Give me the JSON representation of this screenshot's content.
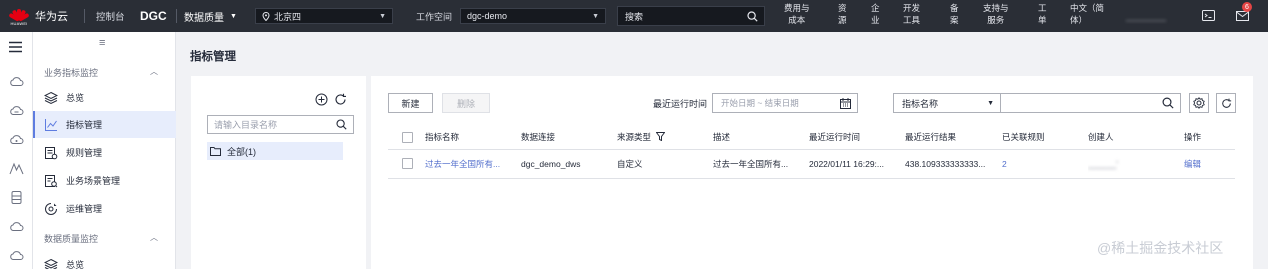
{
  "topbar": {
    "logo_text": "HUAWEI",
    "brand": "华为云",
    "console": "控制台",
    "product": "DGC",
    "module": "数据质量",
    "region": "北京四",
    "workspace_label": "工作空间",
    "workspace": "dgc-demo",
    "search_placeholder": "搜索",
    "nav": [
      {
        "l1": "费用与",
        "l2": "成本"
      },
      {
        "l1": "资",
        "l2": "源"
      },
      {
        "l1": "企",
        "l2": "业"
      },
      {
        "l1": "开发",
        "l2": "工具"
      },
      {
        "l1": "备",
        "l2": "案"
      },
      {
        "l1": "支持与",
        "l2": "服务"
      },
      {
        "l1": "工",
        "l2": "单"
      },
      {
        "l1": "中文（简",
        "l2": "体）"
      }
    ],
    "user": "________",
    "badge": "6"
  },
  "sidebar": {
    "collapse_icon": "menu-collapse-icon",
    "group1": "业务指标监控",
    "group1_items": [
      {
        "label": "总览",
        "icon": "layers-icon"
      },
      {
        "label": "指标管理",
        "icon": "chart-line-icon"
      },
      {
        "label": "规则管理",
        "icon": "rule-doc-icon"
      },
      {
        "label": "业务场景管理",
        "icon": "scene-doc-icon"
      },
      {
        "label": "运维管理",
        "icon": "ops-gear-icon"
      }
    ],
    "group2": "数据质量监控",
    "group2_items": [
      {
        "label": "总览",
        "icon": "layers-icon"
      }
    ]
  },
  "page": {
    "title": "指标管理"
  },
  "tree": {
    "search_placeholder": "请输入目录名称",
    "root_node": "全部(1)"
  },
  "toolbar": {
    "new_label": "新建",
    "delete_label": "删除",
    "last_run_label": "最近运行时间",
    "date_placeholder": "开始日期 ~ 结束日期",
    "filter_field": "指标名称",
    "filter_value": ""
  },
  "table": {
    "columns": [
      "指标名称",
      "数据连接",
      "来源类型",
      "描述",
      "最近运行时间",
      "最近运行结果",
      "已关联规则",
      "创建人",
      "操作"
    ],
    "rows": [
      {
        "name": "过去一年全国所有...",
        "connection": "dgc_demo_dws",
        "source_type": "自定义",
        "description": "过去一年全国所有...",
        "last_run_time": "2022/01/11 16:29:...",
        "last_run_result": "438.109333333333...",
        "linked_rules": "2",
        "creator": "______'",
        "action": "编辑"
      }
    ]
  },
  "watermark": "@稀土掘金技术社区",
  "colors": {
    "topbar_bg": "#2a2e36",
    "accent": "#5e7ce0",
    "link": "#526ecc",
    "active_bg": "#e7edfc",
    "brand_red": "#e60012"
  }
}
